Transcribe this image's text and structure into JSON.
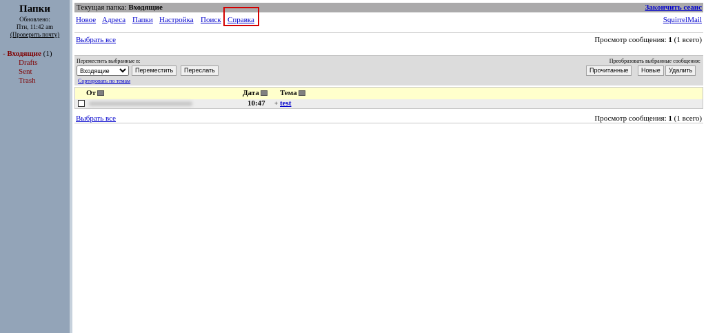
{
  "sidebar": {
    "title": "Папки",
    "updated_label": "Обновлено:",
    "updated_time": "Птн, 11:42 am",
    "check_mail": "(Проверить почту)",
    "inbox": {
      "bullet": "-",
      "label": "Входящие",
      "count": "(1)"
    },
    "folders": [
      "Drafts",
      "Sent",
      "Trash"
    ]
  },
  "header": {
    "current_folder_label": "Текущая папка:",
    "current_folder": "Входящие",
    "logout": "Закончить сеанс"
  },
  "menu": {
    "new": "Новое",
    "addresses": "Адреса",
    "folders": "Папки",
    "options": "Настройка",
    "search": "Поиск",
    "help": "Справка",
    "brand": "SquirrelMail"
  },
  "toolbar": {
    "select_all": "Выбрать все",
    "view_prefix": "Просмотр сообщения:",
    "view_count": "1",
    "view_suffix": "(1 всего)"
  },
  "controls": {
    "move_label": "Переместить выбранные в:",
    "convert_label": "Преобразовать выбранные сообщения:",
    "folder_select": "Входящие",
    "move_button": "Переместить",
    "forward_button": "Переслать",
    "read_button": "Прочитанные",
    "new_button": "Новые",
    "delete_button": "Удалить",
    "sort_threads": "Сортировать по темам"
  },
  "message_list": {
    "col_from": "От",
    "col_date": "Дата",
    "col_subject": "Тема",
    "rows": [
      {
        "time": "10:47",
        "subject_prefix": "+",
        "subject": "test"
      }
    ]
  },
  "colors": {
    "sidebar": "#93a4b8",
    "topbar": "#abaaab",
    "list_header": "#ffffcc",
    "highlight_box": "#d40000"
  }
}
